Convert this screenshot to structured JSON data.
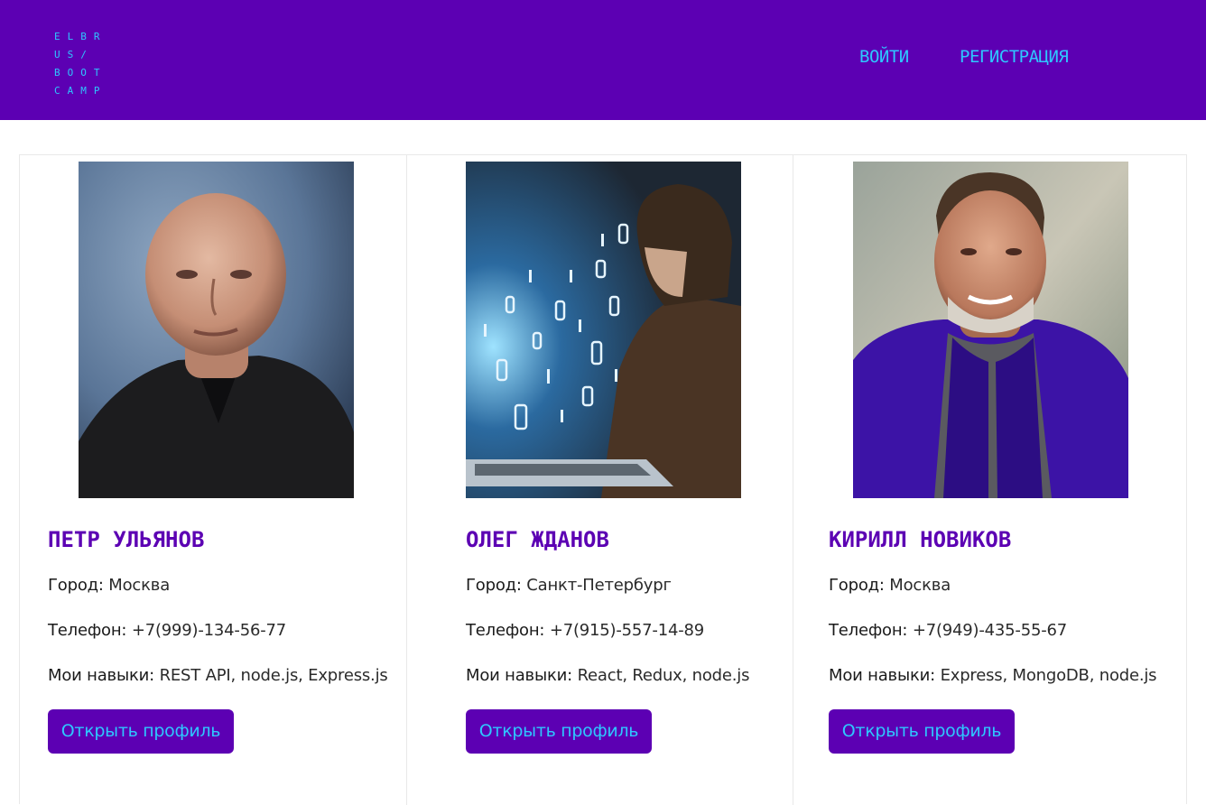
{
  "header": {
    "logo_lines": [
      "ELBR",
      "US/",
      "BOOT",
      "CAMP"
    ],
    "nav": {
      "login": "ВОЙТИ",
      "register": "РЕГИСТРАЦИЯ"
    }
  },
  "colors": {
    "header_bg": "#5c00b3",
    "accent": "#2ec7ff",
    "name": "#5c00b3"
  },
  "cards": [
    {
      "name": "ПЕТР УЛЬЯНОВ",
      "city_label": "Город:",
      "city": "Москва",
      "phone_label": "Телефон:",
      "phone": "+7(999)-134-56-77",
      "skills_label": "Мои навыки:",
      "skills": "REST API, node.js, Express.js",
      "button": "Открыть профиль",
      "photo_icon": "profile-photo"
    },
    {
      "name": "ОЛЕГ ЖДАНОВ",
      "city_label": "Город:",
      "city": "Санкт-Петербург",
      "phone_label": "Телефон:",
      "phone": "+7(915)-557-14-89",
      "skills_label": "Мои навыки:",
      "skills": "React, Redux, node.js",
      "button": "Открыть профиль",
      "photo_icon": "profile-photo"
    },
    {
      "name": "КИРИЛЛ НОВИКОВ",
      "city_label": "Город:",
      "city": "Москва",
      "phone_label": "Телефон:",
      "phone": "+7(949)-435-55-67",
      "skills_label": "Мои навыки:",
      "skills": "Express, MongoDB, node.js",
      "button": "Открыть профиль",
      "photo_icon": "profile-photo"
    }
  ]
}
